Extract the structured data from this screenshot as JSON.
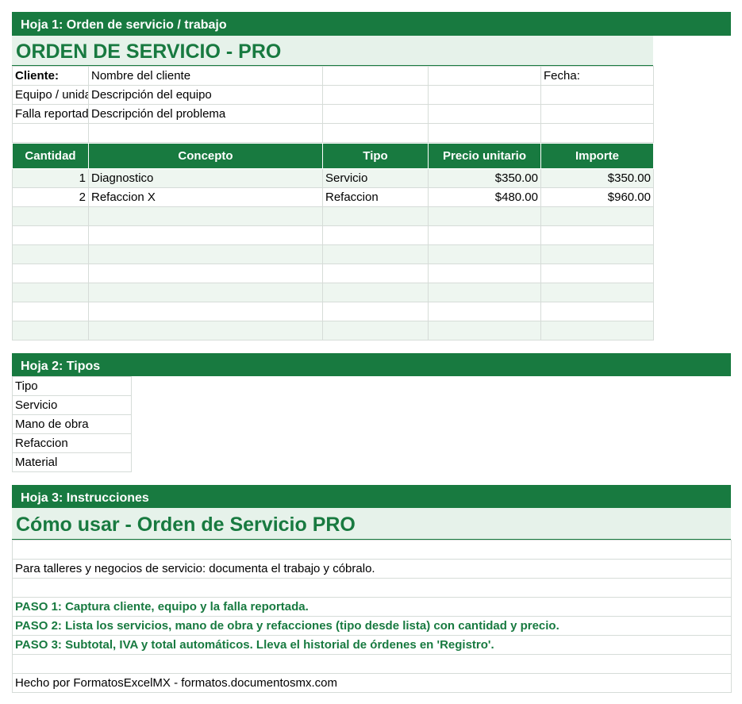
{
  "sheet1": {
    "band": "Hoja 1: Orden de servicio / trabajo",
    "title": "ORDEN DE SERVICIO - PRO",
    "info_rows": [
      {
        "label": "Cliente:",
        "value": "Nombre del cliente",
        "extra": "Fecha:"
      },
      {
        "label": "Equipo / unidad:",
        "value": "Descripción del equipo",
        "extra": ""
      },
      {
        "label": "Falla reportada:",
        "value": "Descripción del problema",
        "extra": ""
      }
    ],
    "headers": [
      "Cantidad",
      "Concepto",
      "Tipo",
      "Precio unitario",
      "Importe"
    ],
    "rows": [
      {
        "cantidad": "1",
        "concepto": "Diagnostico",
        "tipo": "Servicio",
        "precio": "$350.00",
        "importe": "$350.00"
      },
      {
        "cantidad": "2",
        "concepto": "Refaccion X",
        "tipo": "Refaccion",
        "precio": "$480.00",
        "importe": "$960.00"
      }
    ]
  },
  "sheet2": {
    "band": "Hoja 2: Tipos",
    "items": [
      "Tipo",
      "Servicio",
      "Mano de obra",
      "Refaccion",
      "Material"
    ]
  },
  "sheet3": {
    "band": "Hoja 3: Instrucciones",
    "title": "Cómo usar - Orden de Servicio PRO",
    "intro": "Para talleres y negocios de servicio: documenta el trabajo y cóbralo.",
    "steps": [
      "PASO 1: Captura cliente, equipo y la falla reportada.",
      "PASO 2: Lista los servicios, mano de obra y refacciones (tipo desde lista) con cantidad y precio.",
      "PASO 3: Subtotal, IVA y total automáticos. Lleva el historial de órdenes en 'Registro'."
    ],
    "footer": "Hecho por FormatosExcelMX - formatos.documentosmx.com"
  },
  "colors": {
    "accent": "#187a40",
    "light": "#e6f2ea"
  }
}
